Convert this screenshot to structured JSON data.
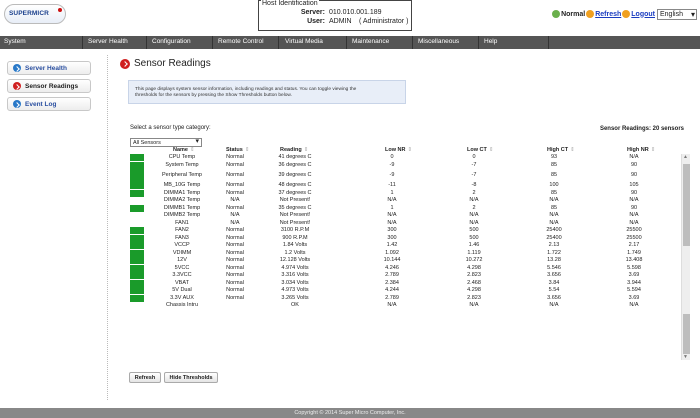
{
  "brand": {
    "logo_text": "SUPERMICR"
  },
  "host": {
    "legend": "Host Identification",
    "server_label": "Server:",
    "server_value": "010.010.001.189",
    "user_label": "User:",
    "user_value": "ADMIN",
    "user_role": "( Administrator )"
  },
  "topright": {
    "status": "Normal",
    "refresh": "Refresh",
    "logout": "Logout",
    "language": "English"
  },
  "menu": [
    "System",
    "Server Health",
    "Configuration",
    "Remote Control",
    "Virtual Media",
    "Maintenance",
    "Miscellaneous",
    "Help"
  ],
  "sidebar": {
    "items": [
      {
        "label": "Server Health"
      },
      {
        "label": "Sensor Readings"
      },
      {
        "label": "Event Log"
      }
    ]
  },
  "page": {
    "title": "Sensor Readings",
    "info_line1": "This page displays system sensor information, including readings and status. You can toggle viewing the",
    "info_line2": "thresholds for the sensors by pressing the Show Thresholds button below.",
    "select_label": "Select a sensor type category:",
    "select_value": "All Sensors",
    "count_label": "Sensor Readings: 20 sensors"
  },
  "table": {
    "headers": [
      "Name",
      "Status",
      "Reading",
      "Low NR",
      "Low CT",
      "High CT",
      "High NR"
    ],
    "rows": [
      [
        "CPU Temp",
        "Normal",
        "41 degrees C",
        "0",
        "0",
        "93",
        "N/A"
      ],
      [
        "System Temp",
        "Normal",
        "36 degrees C",
        "-9",
        "-7",
        "85",
        "90"
      ],
      [
        "Peripheral Temp",
        "Normal",
        "39 degrees C",
        "-9",
        "-7",
        "85",
        "90"
      ],
      [
        "MB_10G Temp",
        "Normal",
        "48 degrees C",
        "-11",
        "-8",
        "100",
        "105"
      ],
      [
        "DIMMA1 Temp",
        "Normal",
        "37 degrees C",
        "1",
        "2",
        "85",
        "90"
      ],
      [
        "DIMMA2 Temp",
        "N/A",
        "Not Present!",
        "N/A",
        "N/A",
        "N/A",
        "N/A"
      ],
      [
        "DIMMB1 Temp",
        "Normal",
        "35 degrees C",
        "1",
        "2",
        "85",
        "90"
      ],
      [
        "DIMMB2 Temp",
        "N/A",
        "Not Present!",
        "N/A",
        "N/A",
        "N/A",
        "N/A"
      ],
      [
        "FAN1",
        "N/A",
        "Not Present!",
        "N/A",
        "N/A",
        "N/A",
        "N/A"
      ],
      [
        "FAN2",
        "Normal",
        "3100 R.P.M",
        "300",
        "500",
        "25400",
        "25500"
      ],
      [
        "FAN3",
        "Normal",
        "900 R.P.M",
        "300",
        "500",
        "25400",
        "25500"
      ],
      [
        "VCCP",
        "Normal",
        "1.84 Volts",
        "1.42",
        "1.46",
        "2.13",
        "2.17"
      ],
      [
        "VDIMM",
        "Normal",
        "1.2 Volts",
        "1.092",
        "1.119",
        "1.722",
        "1.749"
      ],
      [
        "12V",
        "Normal",
        "12.128 Volts",
        "10.144",
        "10.272",
        "13.28",
        "13.408"
      ],
      [
        "5VCC",
        "Normal",
        "4.974 Volts",
        "4.246",
        "4.298",
        "5.546",
        "5.598"
      ],
      [
        "3.3VCC",
        "Normal",
        "3.316 Volts",
        "2.789",
        "2.823",
        "3.656",
        "3.69"
      ],
      [
        "VBAT",
        "Normal",
        "3.034 Volts",
        "2.384",
        "2.468",
        "3.84",
        "3.944"
      ],
      [
        "5V Dual",
        "Normal",
        "4.973 Volts",
        "4.244",
        "4.298",
        "5.54",
        "5.594"
      ],
      [
        "3.3V AUX",
        "Normal",
        "3.265 Volts",
        "2.789",
        "2.823",
        "3.656",
        "3.69"
      ],
      [
        "Chassis Intru",
        "",
        "OK",
        "N/A",
        "N/A",
        "N/A",
        "N/A"
      ]
    ],
    "status_ok": [
      true,
      true,
      true,
      true,
      true,
      false,
      true,
      false,
      false,
      true,
      true,
      true,
      true,
      true,
      true,
      true,
      true,
      true,
      true,
      false
    ]
  },
  "buttons": {
    "refresh": "Refresh",
    "thresholds": "Hide Thresholds"
  },
  "footer": "Copyright © 2014 Super Micro Computer, Inc.",
  "colors": {
    "status_green": "#1a9b2a",
    "menubar": "#555555",
    "link": "#1a3cc0"
  }
}
